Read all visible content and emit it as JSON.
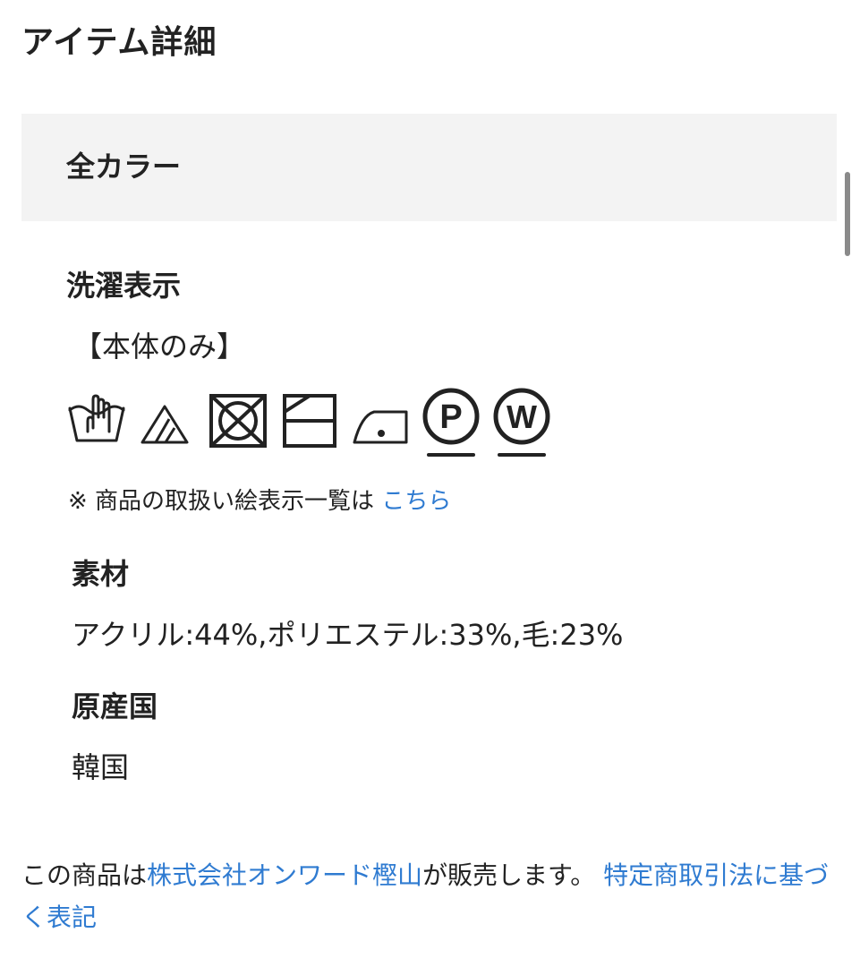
{
  "page": {
    "title": "アイテム詳細"
  },
  "color_selector": {
    "label": "全カラー"
  },
  "care": {
    "heading": "洗濯表示",
    "scope": "【本体のみ】",
    "icons": [
      "hand-wash-icon",
      "non-chlorine-bleach-icon",
      "no-tumble-dry-icon",
      "drip-dry-in-shade-icon",
      "low-temperature-iron-icon",
      "professional-dry-clean-p-icon",
      "professional-wet-clean-w-icon"
    ],
    "note_prefix": "※ 商品の取扱い絵表示一覧は",
    "note_link": "こちら"
  },
  "material": {
    "heading": "素材",
    "value": "アクリル:44%,ポリエステル:33%,毛:23%"
  },
  "origin": {
    "heading": "原産国",
    "value": "韓国"
  },
  "seller": {
    "prefix": "この商品は",
    "company_link": "株式会社オンワード樫山",
    "suffix": "が販売します。",
    "law_link": "特定商取引法に基づく表記"
  },
  "colors": {
    "text": "#222222",
    "link": "#2f7bd1",
    "panel_bg": "#f3f3f3",
    "scrollbar": "#8a8a8a"
  }
}
